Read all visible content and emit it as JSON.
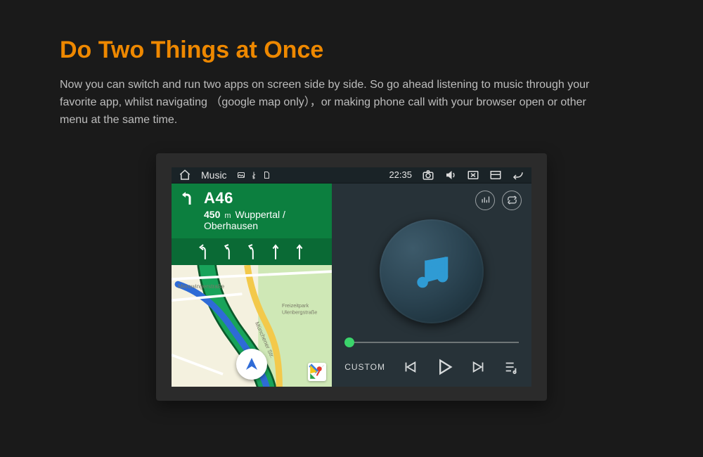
{
  "page": {
    "title": "Do Two Things at Once",
    "body": "Now you can switch and run two apps on screen side by side. So go ahead listening to music through your favorite app, whilst navigating （google map only），or making phone call with your browser open or other menu at the same time."
  },
  "sysbar": {
    "app_label": "Music",
    "clock": "22:35"
  },
  "nav": {
    "road": "A46",
    "distance_value": "450",
    "distance_unit": "m",
    "destination": "Wuppertal / Oberhausen",
    "map_labels": {
      "road_a": "Merowingerstraße",
      "road_b": "Münchener Str.",
      "poi_a": "Freizeitpark Ulenbergstraße"
    }
  },
  "music": {
    "mode_label": "CUSTOM"
  }
}
